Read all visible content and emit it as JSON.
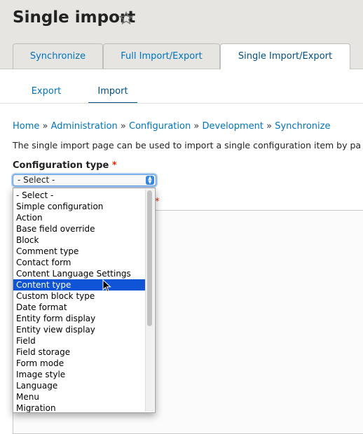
{
  "page": {
    "title": "Single import"
  },
  "tabs": [
    {
      "label": "Synchronize"
    },
    {
      "label": "Full Import/Export"
    },
    {
      "label": "Single Import/Export",
      "active": true
    }
  ],
  "subtabs": [
    {
      "label": "Export"
    },
    {
      "label": "Import",
      "active": true
    }
  ],
  "breadcrumb": [
    "Home",
    "Administration",
    "Configuration",
    "Development",
    "Synchronize"
  ],
  "breadcrumb_separator": "»",
  "description": "The single import page can be used to import a single configuration item by pa",
  "config_type": {
    "label": "Configuration type",
    "required_marker": "*",
    "value": "- Select -",
    "options": [
      "- Select -",
      "Simple configuration",
      "Action",
      "Base field override",
      "Block",
      "Comment type",
      "Contact form",
      "Content Language Settings",
      "Content type",
      "Custom block type",
      "Date format",
      "Entity form display",
      "Entity view display",
      "Field",
      "Field storage",
      "Form mode",
      "Image style",
      "Language",
      "Menu",
      "Migration"
    ],
    "highlighted_option": "Content type"
  },
  "second_required_marker": "*",
  "colors": {
    "link": "#0074bd",
    "header_bg": "#e6e5e1",
    "highlight": "#0f54d6",
    "required": "#e32700"
  }
}
